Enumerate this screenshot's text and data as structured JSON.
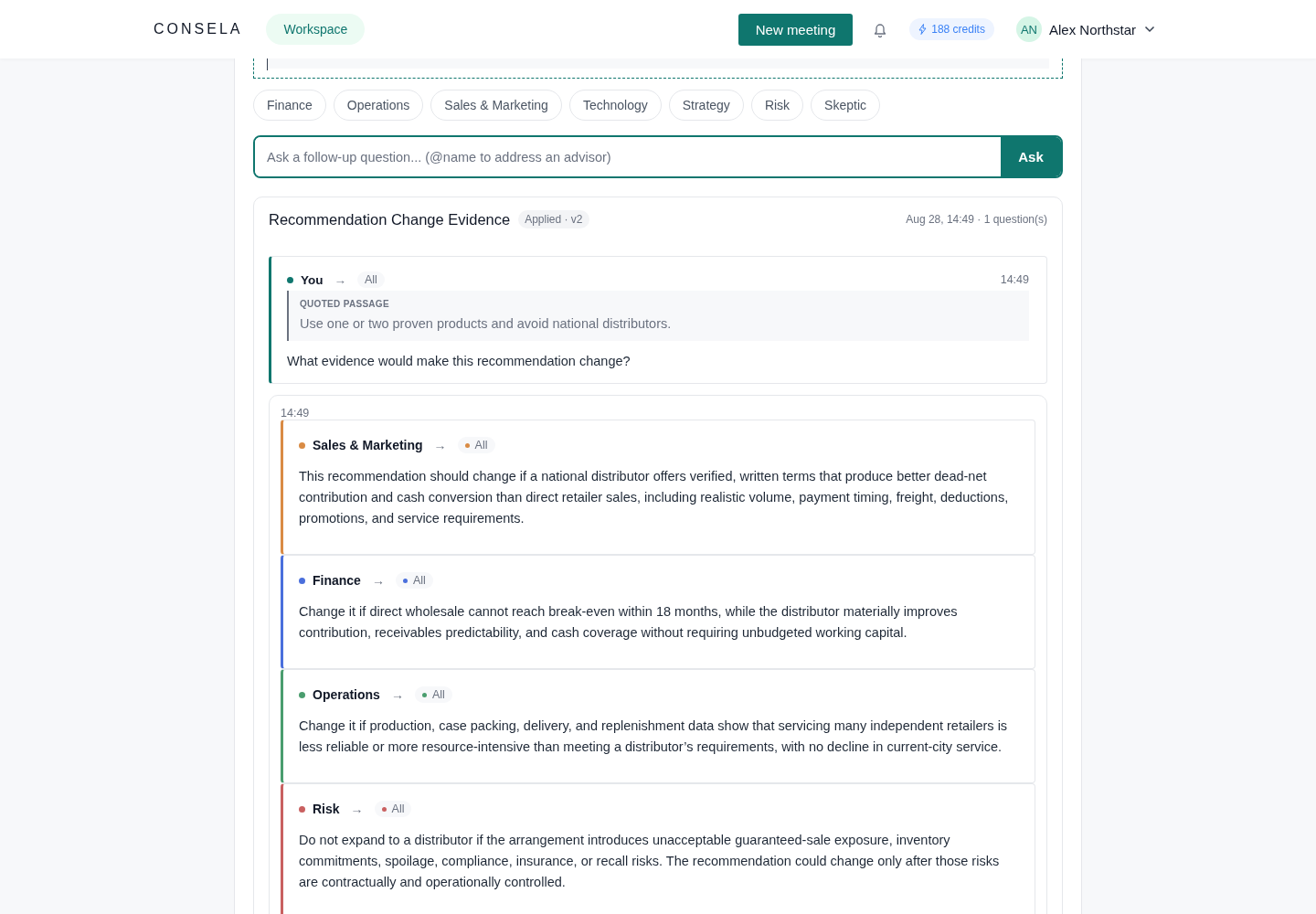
{
  "header": {
    "logo": "CONSELA",
    "workspace_tab": {
      "label": "Workspace",
      "selected": true
    },
    "new_meeting_button": "New meeting",
    "credits": "188 credits",
    "user": {
      "initials": "AN",
      "name": "Alex Northstar"
    }
  },
  "advisor_chips": [
    "Finance",
    "Operations",
    "Sales & Marketing",
    "Technology",
    "Strategy",
    "Risk",
    "Skeptic"
  ],
  "ask": {
    "placeholder": "Ask a follow-up question... (@name to address an advisor)",
    "button": "Ask"
  },
  "thread": {
    "title": "Recommendation Change Evidence",
    "badge": "Applied · v2",
    "meta": "Aug 28, 14:49 · 1 question(s)",
    "question": {
      "author": "You",
      "arrow": "→",
      "target": "All",
      "time": "14:49",
      "quote_label": "QUOTED PASSAGE",
      "quote": "Use one or two proven products and avoid national distributors.",
      "text": "What evidence would make this recommendation change?"
    },
    "responses": {
      "time": "14:49",
      "items": [
        {
          "name": "Sales & Marketing",
          "color": "#d98b44",
          "arrow": "→",
          "target": "All",
          "text": "This recommendation should change if a national distributor offers verified, written terms that produce better dead-net contribution and cash conversion than direct retailer sales, including realistic volume, payment timing, freight, deductions, promotions, and service requirements."
        },
        {
          "name": "Finance",
          "color": "#4a6fdc",
          "arrow": "→",
          "target": "All",
          "text": "Change it if direct wholesale cannot reach break-even within 18 months, while the distributor materially improves contribution, receivables predictability, and cash coverage without requiring unbudgeted working capital."
        },
        {
          "name": "Operations",
          "color": "#4a9d6e",
          "arrow": "→",
          "target": "All",
          "text": "Change it if production, case packing, delivery, and replenishment data show that servicing many independent retailers is less reliable or more resource-intensive than meeting a distributor’s requirements, with no decline in current-city service."
        },
        {
          "name": "Risk",
          "color": "#c96060",
          "arrow": "→",
          "target": "All",
          "text": "Do not expand to a distributor if the arrangement introduces unacceptable guaranteed-sale exposure, inventory commitments, spoilage, compliance, insurance, or recall risks. The recommendation could change only after those risks are contractually and operationally controlled."
        }
      ]
    }
  }
}
